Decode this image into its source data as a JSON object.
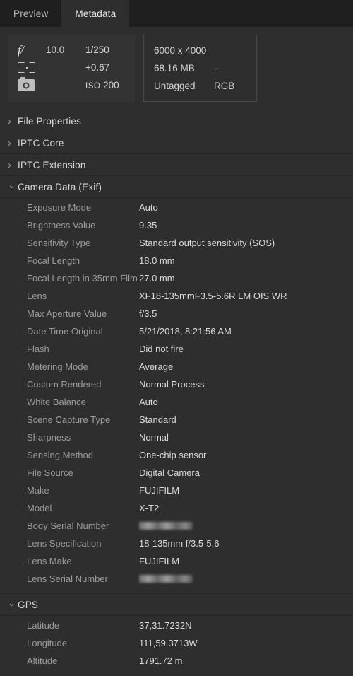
{
  "tabs": [
    {
      "label": "Preview",
      "name": "tab-preview",
      "active": false
    },
    {
      "label": "Metadata",
      "name": "tab-metadata",
      "active": true
    }
  ],
  "summary": {
    "exif_box": {
      "aperture_icon": "aperture-f-stop-icon",
      "aperture": "10.0",
      "shutter_speed": "1/250",
      "metering_icon": "metering-bracket-icon",
      "exposure_compensation": "+0.67",
      "camera_icon": "camera-icon",
      "iso_label": "ISO",
      "iso_value": "200"
    },
    "props_box": {
      "dimensions": "6000 x 4000",
      "file_size": "68.16 MB",
      "resolution": "--",
      "color_profile": "Untagged",
      "color_mode": "RGB"
    }
  },
  "sections": [
    {
      "title": "File Properties",
      "expanded": false,
      "rows": []
    },
    {
      "title": "IPTC Core",
      "expanded": false,
      "rows": []
    },
    {
      "title": "IPTC Extension",
      "expanded": false,
      "rows": []
    },
    {
      "title": "Camera Data (Exif)",
      "expanded": true,
      "rows": [
        {
          "label": "Exposure Mode",
          "value": "Auto"
        },
        {
          "label": "Brightness Value",
          "value": "9.35"
        },
        {
          "label": "Sensitivity Type",
          "value": "Standard output sensitivity (SOS)"
        },
        {
          "label": "Focal Length",
          "value": "18.0 mm"
        },
        {
          "label": "Focal Length in 35mm Film",
          "value": "27.0 mm"
        },
        {
          "label": "Lens",
          "value": "XF18-135mmF3.5-5.6R LM OIS WR"
        },
        {
          "label": "Max Aperture Value",
          "value": "f/3.5"
        },
        {
          "label": "Date Time Original",
          "value": "5/21/2018, 8:21:56 AM"
        },
        {
          "label": "Flash",
          "value": "Did not fire"
        },
        {
          "label": "Metering Mode",
          "value": "Average"
        },
        {
          "label": "Custom Rendered",
          "value": "Normal Process"
        },
        {
          "label": "White Balance",
          "value": "Auto"
        },
        {
          "label": "Scene Capture Type",
          "value": "Standard"
        },
        {
          "label": "Sharpness",
          "value": "Normal"
        },
        {
          "label": "Sensing Method",
          "value": "One-chip sensor"
        },
        {
          "label": "File Source",
          "value": "Digital Camera"
        },
        {
          "label": "Make",
          "value": "FUJIFILM"
        },
        {
          "label": "Model",
          "value": "X-T2"
        },
        {
          "label": "Body Serial Number",
          "value": "",
          "redacted": true
        },
        {
          "label": "Lens Specification",
          "value": "18-135mm f/3.5-5.6"
        },
        {
          "label": "Lens Make",
          "value": "FUJIFILM"
        },
        {
          "label": "Lens Serial Number",
          "value": "",
          "redacted": true
        }
      ]
    },
    {
      "title": "GPS",
      "expanded": true,
      "rows": [
        {
          "label": "Latitude",
          "value": "37,31.7232N"
        },
        {
          "label": "Longitude",
          "value": "111,59.3713W"
        },
        {
          "label": "Altitude",
          "value": "1791.72 m"
        }
      ]
    }
  ],
  "colors": {
    "background": "#2e2e2e",
    "tabbar": "#1f1f1f",
    "panel": "#333333",
    "label_text": "#9c9c9c",
    "value_text": "#dcdcdc",
    "divider": "#262626"
  }
}
